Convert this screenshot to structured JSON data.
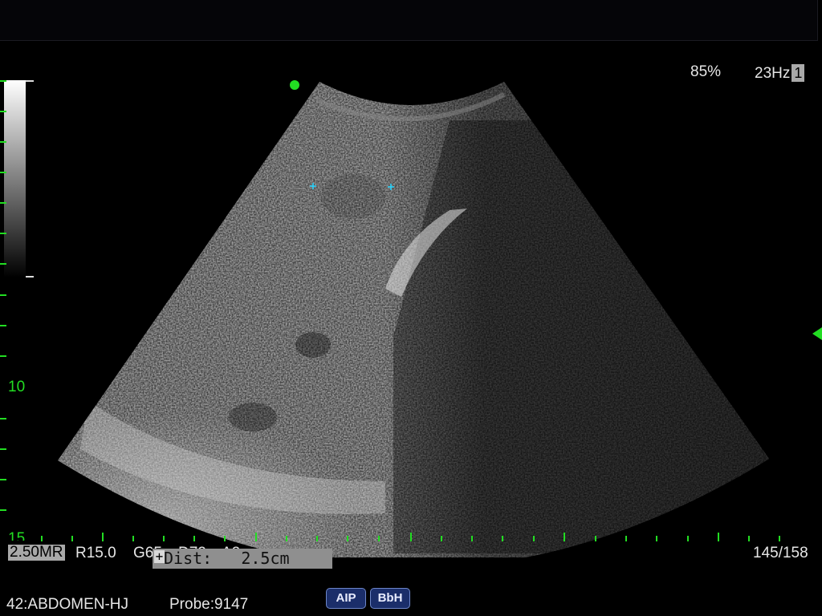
{
  "status": {
    "power": "85%",
    "frame_rate": "23Hz",
    "zone_count": "1"
  },
  "scan_params": {
    "frequency": "2.50MR",
    "resolution": "R15.0",
    "gain": "G65",
    "dynamic_range": "D72",
    "acoustic_output": "A2",
    "frame_counter": "145/158"
  },
  "measurement": {
    "label": "Dist:",
    "value": "2.5cm"
  },
  "depth_scale": {
    "labels": [
      "10",
      "15"
    ]
  },
  "footer": {
    "preset": "42:ABDOMEN-HJ",
    "probe": "Probe:9147"
  },
  "mode_buttons": [
    {
      "label": "AIP"
    },
    {
      "label": "BbH"
    }
  ],
  "colors": {
    "scale_green": "#22dd22",
    "caliper_cyan": "#27d4ff",
    "button_blue": "#1b2e6a"
  }
}
